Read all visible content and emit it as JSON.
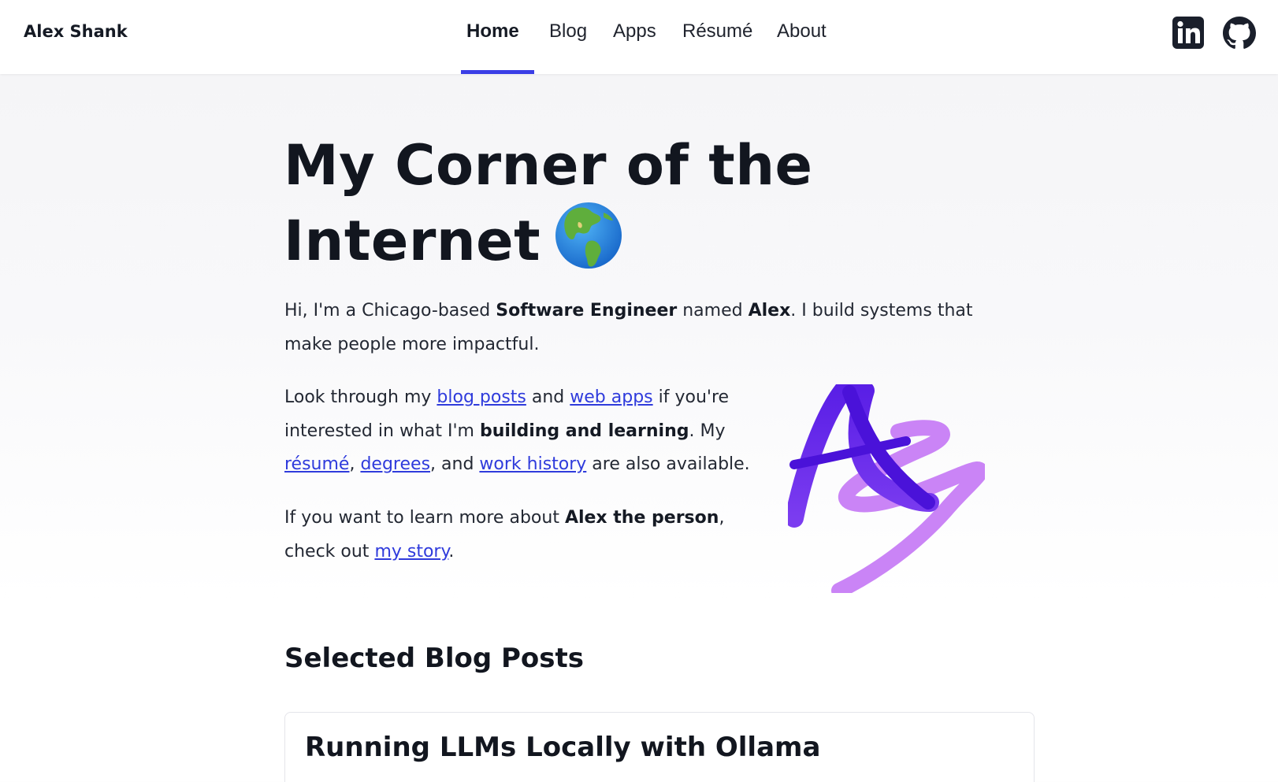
{
  "header": {
    "brand": "Alex Shank",
    "nav": [
      {
        "label": "Home",
        "active": true
      },
      {
        "label": "Blog",
        "active": false
      },
      {
        "label": "Apps",
        "active": false
      },
      {
        "label": "Résumé",
        "active": false
      },
      {
        "label": "About",
        "active": false
      }
    ],
    "social": [
      {
        "icon": "linkedin-icon"
      },
      {
        "icon": "github-icon"
      }
    ],
    "accent_color": "#3a3ee6"
  },
  "hero": {
    "title_line1": "My Corner of the",
    "title_line2": "Internet",
    "title_icon": "globe-americas-icon",
    "intro": {
      "t1": "Hi, I'm a Chicago-based ",
      "b1": "Software Engineer",
      "t2": " named ",
      "b2": "Alex",
      "t3": ". I build systems that make people more impactful."
    },
    "explore": {
      "t1": "Look through my ",
      "link_blog": "blog posts",
      "t2": " and ",
      "link_apps": "web apps",
      "t3": " if you're interested in what I'm ",
      "b1": "building and learning",
      "t4": ". My ",
      "link_resume": "résumé",
      "t5": ", ",
      "link_degrees": "degrees",
      "t6": ", and ",
      "link_work": "work history",
      "t7": " are also available."
    },
    "story": {
      "t1": "If you want to learn more about ",
      "b1": "Alex the person",
      "t2": ", check out ",
      "link_story": "my story",
      "t3": "."
    },
    "monogram_icon": "as-monogram-logo",
    "monogram_colors": [
      "#5a1fe6",
      "#c77df5"
    ]
  },
  "blog": {
    "section_title": "Selected Blog Posts",
    "posts": [
      {
        "title": "Running LLMs Locally with Ollama"
      }
    ]
  }
}
